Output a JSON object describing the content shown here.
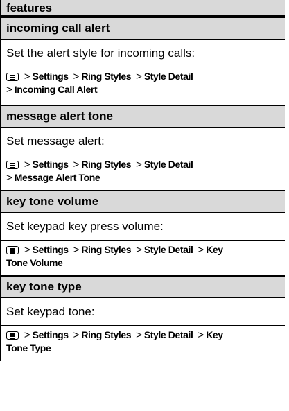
{
  "header": {
    "title": "features"
  },
  "sections": [
    {
      "title": "incoming call alert",
      "description": "Set the alert style for incoming calls:",
      "path_line1": [
        "Settings",
        "Ring Styles",
        "Style Detail"
      ],
      "path_line2": "Incoming Call Alert"
    },
    {
      "title": "message alert tone",
      "description": "Set message alert:",
      "path_line1": [
        "Settings",
        "Ring Styles",
        "Style Detail"
      ],
      "path_line2": "Message Alert Tone"
    },
    {
      "title": "key tone volume",
      "description": "Set keypad key press volume:",
      "path_line1": [
        "Settings",
        "Ring Styles",
        "Style Detail",
        "Key"
      ],
      "path_line2": "Tone Volume"
    },
    {
      "title": "key tone type",
      "description": "Set keypad tone:",
      "path_line1": [
        "Settings",
        "Ring Styles",
        "Style Detail",
        "Key"
      ],
      "path_line2": "Tone Type"
    }
  ],
  "separator": ">",
  "icons": {
    "menu_key": "menu-key-icon"
  }
}
